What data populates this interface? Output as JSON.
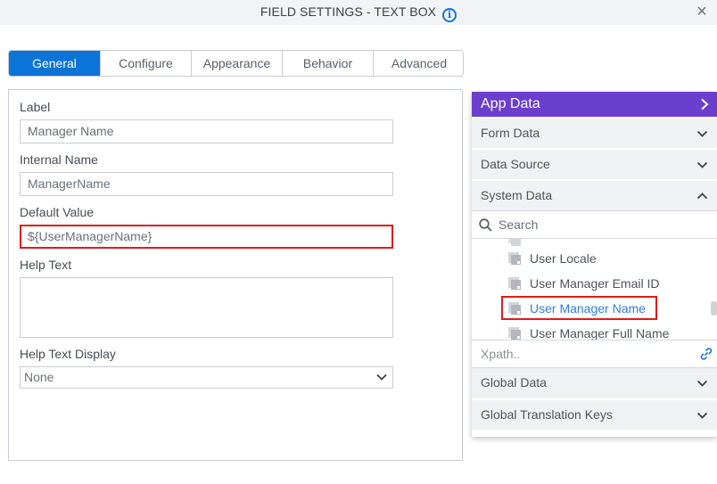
{
  "dialog": {
    "title": "FIELD SETTINGS - TEXT BOX",
    "info_icon": "i",
    "close_icon": "×"
  },
  "tabs": [
    {
      "label": "General",
      "active": true
    },
    {
      "label": "Configure",
      "active": false
    },
    {
      "label": "Appearance",
      "active": false
    },
    {
      "label": "Behavior",
      "active": false
    },
    {
      "label": "Advanced",
      "active": false
    }
  ],
  "form": {
    "label": {
      "caption": "Label",
      "value": "Manager Name"
    },
    "internal_name": {
      "caption": "Internal Name",
      "value": "ManagerName"
    },
    "default_value": {
      "caption": "Default Value",
      "value": "${UserManagerName}"
    },
    "help_text": {
      "caption": "Help Text",
      "value": ""
    },
    "help_text_display": {
      "caption": "Help Text Display",
      "value": "None"
    }
  },
  "app_data": {
    "title": "App Data",
    "sections_top": [
      {
        "label": "Form Data",
        "expanded": false
      },
      {
        "label": "Data Source",
        "expanded": false
      },
      {
        "label": "System Data",
        "expanded": true
      }
    ],
    "search_placeholder": "Search",
    "tree_items": [
      {
        "label": "User Locale",
        "selected": false
      },
      {
        "label": "User Manager Email ID",
        "selected": false
      },
      {
        "label": "User Manager Name",
        "selected": true
      },
      {
        "label": "User Manager Full Name",
        "selected": false
      }
    ],
    "xpath_placeholder": "Xpath..",
    "sections_bottom": [
      {
        "label": "Global Data",
        "expanded": false
      },
      {
        "label": "Global Translation Keys",
        "expanded": false
      }
    ]
  },
  "colors": {
    "accent": "#0b74d9",
    "app_data_header": "#6b3fce",
    "highlight": "#e01b1b",
    "selected_text": "#2f7de1"
  }
}
